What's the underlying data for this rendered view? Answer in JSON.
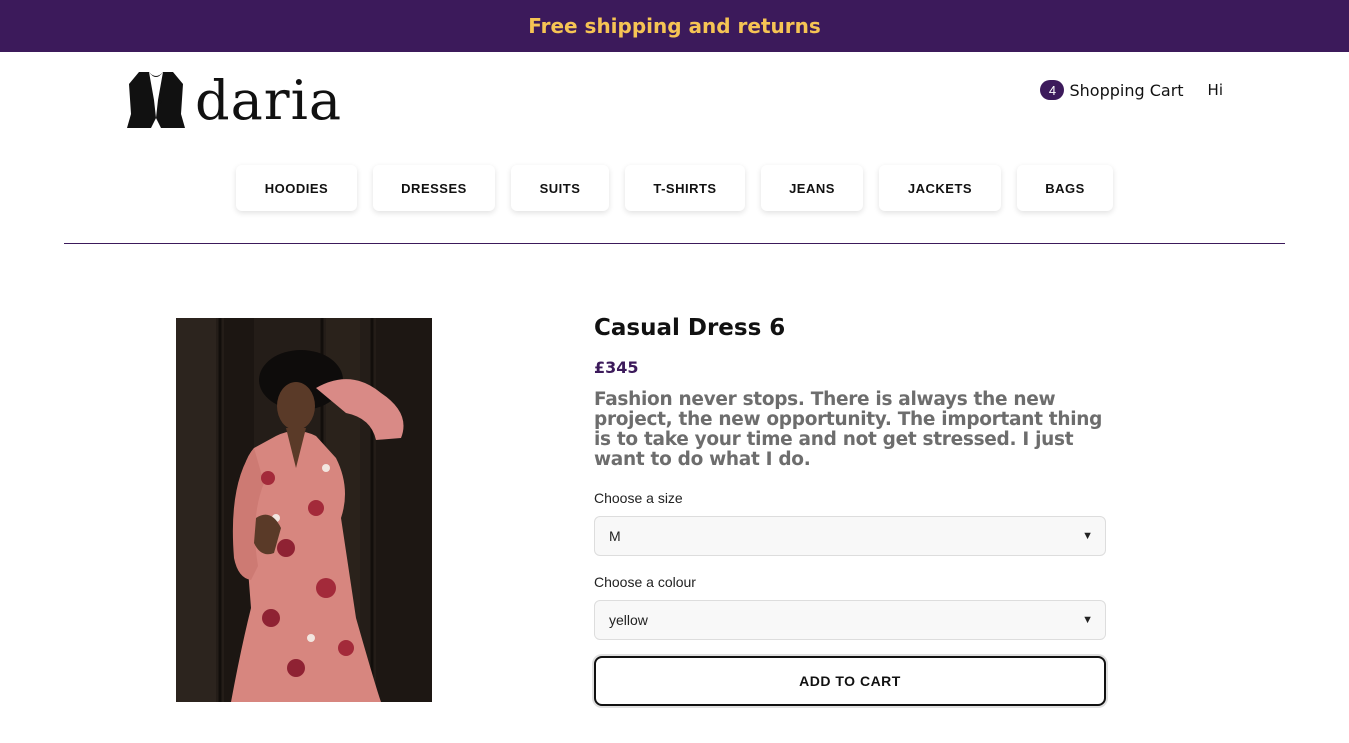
{
  "promo": {
    "text": "Free shipping and returns"
  },
  "brand": {
    "name": "daria",
    "logo_icon": "vest-icon"
  },
  "header": {
    "cart_count": "4",
    "cart_label": "Shopping Cart",
    "greeting": "Hi"
  },
  "nav": {
    "categories": [
      "HOODIES",
      "DRESSES",
      "SUITS",
      "T-SHIRTS",
      "JEANS",
      "JACKETS",
      "BAGS"
    ]
  },
  "product": {
    "title": "Casual Dress 6",
    "price": "£345",
    "description": "Fashion never stops. There is always the new project, the new opportunity. The important thing is to take your time and not get stressed. I just want to do what I do.",
    "size_label": "Choose a size",
    "size_value": "M",
    "colour_label": "Choose a colour",
    "colour_value": "yellow",
    "add_to_cart_label": "ADD TO CART"
  },
  "colors": {
    "accent": "#3c1a5b",
    "promo_text": "#f6c454"
  }
}
